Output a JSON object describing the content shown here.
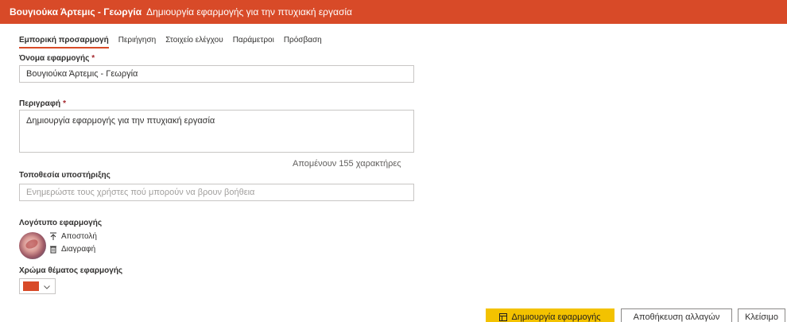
{
  "header": {
    "app_name": "Βουγιούκα Άρτεμις - Γεωργία",
    "app_description": "Δημιουργία εφαρμογής για την πτυχιακή εργασία",
    "background_color": "#d84a28"
  },
  "tabs": [
    {
      "label": "Εμπορική προσαρμογή",
      "active": true
    },
    {
      "label": "Περιήγηση",
      "active": false
    },
    {
      "label": "Στοιχείο ελέγχου",
      "active": false
    },
    {
      "label": "Παράμετροι",
      "active": false
    },
    {
      "label": "Πρόσβαση",
      "active": false
    }
  ],
  "form": {
    "name": {
      "label": "Όνομα εφαρμογής",
      "required_mark": "*",
      "value": "Βουγιούκα Άρτεμις - Γεωργία"
    },
    "description": {
      "label": "Περιγραφή",
      "required_mark": "*",
      "value": "Δημιουργία εφαρμογής για την πτυχιακή εργασία",
      "counter": "Απομένουν 155 χαρακτήρες"
    },
    "support": {
      "label": "Τοποθεσία υποστήριξης",
      "value": "",
      "placeholder": "Ενημερώστε τους χρήστες πού μπορούν να βρουν βοήθεια"
    },
    "logo": {
      "label": "Λογότυπο εφαρμογής",
      "upload_label": "Αποστολή",
      "delete_label": "Διαγραφή",
      "upload_icon": "upload-icon",
      "delete_icon": "trash-icon"
    },
    "theme_color": {
      "label": "Χρώμα θέματος εφαρμογής",
      "value": "#d84a28"
    }
  },
  "footer": {
    "create_label": "Δημιουργία εφαρμογής",
    "create_icon": "app-icon",
    "save_label": "Αποθήκευση αλλαγών",
    "close_label": "Κλείσιμο",
    "accent_color": "#f3c200"
  }
}
